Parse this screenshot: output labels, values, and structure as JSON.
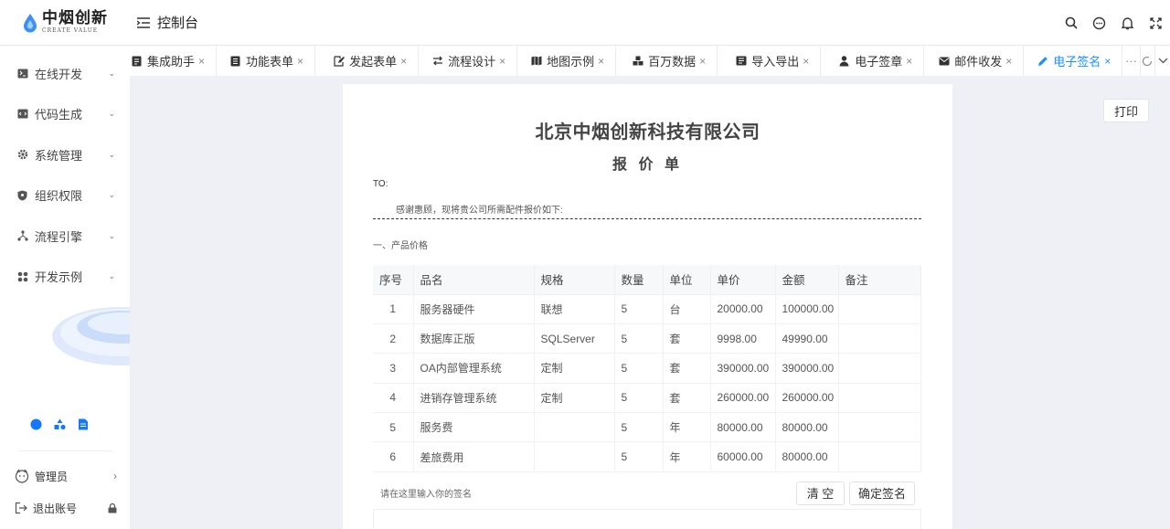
{
  "brand": {
    "name_cn": "中烟创新",
    "name_en": "CREATE VALUE"
  },
  "header": {
    "title": "控制台",
    "actions": [
      "search-icon",
      "message-icon",
      "bell-icon",
      "fullscreen-icon"
    ]
  },
  "sidebar": {
    "items": [
      {
        "label": "在线开发",
        "icon": "terminal-icon"
      },
      {
        "label": "代码生成",
        "icon": "code-icon"
      },
      {
        "label": "系统管理",
        "icon": "gear-icon"
      },
      {
        "label": "组织权限",
        "icon": "shield-icon"
      },
      {
        "label": "流程引擎",
        "icon": "flow-icon"
      },
      {
        "label": "开发示例",
        "icon": "grid-icon"
      }
    ],
    "tools": [
      "theme-icon",
      "apps-icon",
      "doc-icon"
    ],
    "user": "管理员",
    "logout": "退出账号"
  },
  "tabs": [
    {
      "label": "集成助手",
      "icon": "doc-icon"
    },
    {
      "label": "功能表单",
      "icon": "list-icon"
    },
    {
      "label": "发起表单",
      "icon": "edit-icon"
    },
    {
      "label": "流程设计",
      "icon": "swap-icon"
    },
    {
      "label": "地图示例",
      "icon": "map-icon"
    },
    {
      "label": "百万数据",
      "icon": "cubes-icon"
    },
    {
      "label": "导入导出",
      "icon": "import-icon"
    },
    {
      "label": "电子签章",
      "icon": "user-icon"
    },
    {
      "label": "邮件收发",
      "icon": "mail-icon"
    },
    {
      "label": "电子签名",
      "icon": "pen-icon",
      "active": true
    }
  ],
  "tab_tools": {
    "more": "···"
  },
  "doc": {
    "print": "打印",
    "company": "北京中烟创新科技有限公司",
    "title": "报 价 单",
    "to": "TO:",
    "intro": "感谢惠顾，现将贵公司所需配件报价如下:",
    "section": "一、产品价格",
    "columns": [
      "序号",
      "品名",
      "规格",
      "数量",
      "单位",
      "单价",
      "金额",
      "备注"
    ],
    "rows": [
      [
        "1",
        "服务器硬件",
        "联想",
        "5",
        "台",
        "20000.00",
        "100000.00",
        ""
      ],
      [
        "2",
        "数据库正版",
        "SQLServer",
        "5",
        "套",
        "9998.00",
        "49990.00",
        ""
      ],
      [
        "3",
        "OA内部管理系统",
        "定制",
        "5",
        "套",
        "390000.00",
        "390000.00",
        ""
      ],
      [
        "4",
        "进销存管理系统",
        "定制",
        "5",
        "套",
        "260000.00",
        "260000.00",
        ""
      ],
      [
        "5",
        "服务费",
        "",
        "5",
        "年",
        "80000.00",
        "80000.00",
        ""
      ],
      [
        "6",
        "差旅费用",
        "",
        "5",
        "年",
        "60000.00",
        "80000.00",
        ""
      ]
    ],
    "sign_placeholder": "请在这里输入你的签名",
    "clear": "清 空",
    "confirm": "确定签名"
  }
}
